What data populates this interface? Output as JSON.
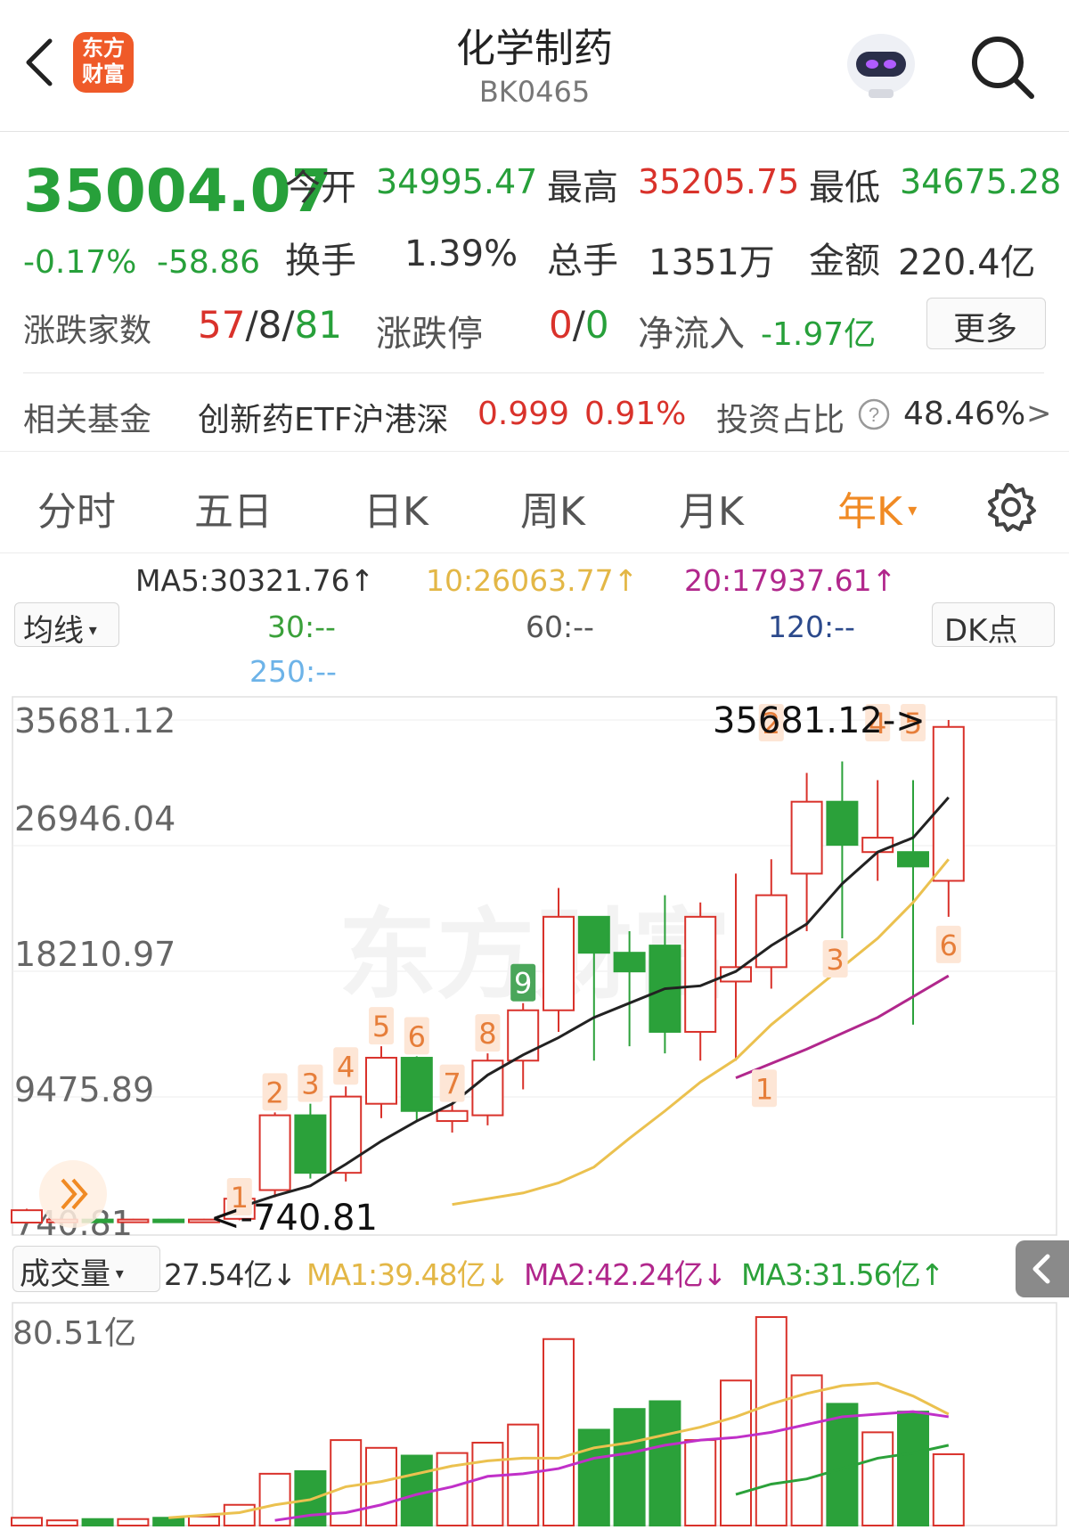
{
  "header": {
    "title": "化学制药",
    "code": "BK0465",
    "logo_line1": "东方",
    "logo_line2": "财富"
  },
  "quote": {
    "price": "35004.07",
    "change_pct": "-0.17%",
    "change": "-58.86",
    "open_label": "今开",
    "open": "34995.47",
    "high_label": "最高",
    "high": "35205.75",
    "low_label": "最低",
    "low": "34675.28",
    "turnover_label": "换手",
    "turnover": "1.39%",
    "volume_label": "总手",
    "volume": "1351万",
    "amount_label": "金额",
    "amount": "220.4亿",
    "breadth_label": "涨跌家数",
    "up": "57",
    "flat": "8",
    "down": "81",
    "sep": "/",
    "limit_label": "涨跌停",
    "limit_up": "0",
    "limit_down": "0",
    "netflow_label": "净流入",
    "netflow": "-1.97亿",
    "more": "更多"
  },
  "fund": {
    "label": "相关基金",
    "name": "创新药ETF沪港深",
    "price": "0.999",
    "pct": "0.91%",
    "ratio_label": "投资占比",
    "ratio": "48.46%",
    "arrow": ">"
  },
  "tabs": [
    {
      "label": "分时"
    },
    {
      "label": "五日"
    },
    {
      "label": "日K"
    },
    {
      "label": "周K"
    },
    {
      "label": "月K"
    },
    {
      "label": "年K"
    }
  ],
  "tab_active_index": 5,
  "ma": {
    "ma5": "MA5:30321.76↑",
    "ma10": "10:26063.77↑",
    "ma20": "20:17937.61↑",
    "ma30": "30:--",
    "ma60": "60:--",
    "ma120": "120:--",
    "ma250": "250:--",
    "selector": "均线",
    "dk": "DK点"
  },
  "colors": {
    "up": "#d9322b",
    "down": "#2ba13a",
    "accent": "#f08a24",
    "ma5": "#222222",
    "ma10": "#ebc14f",
    "ma20": "#b1278c"
  },
  "kline": {
    "y_labels": [
      "35681.12",
      "26946.04",
      "18210.97",
      "9475.89",
      "740.81"
    ],
    "max_label": "35681.12->",
    "min_label": "<-740.81",
    "watermark": "东方财富"
  },
  "volume_panel": {
    "selector": "成交量",
    "value": "27.54亿↓",
    "ma1": "MA1:39.48亿↓",
    "ma2": "MA2:42.24亿↓",
    "ma3": "MA3:31.56亿↑",
    "max_label": "80.51亿"
  },
  "chart_data": {
    "type": "candlestick",
    "title": "",
    "y_range": [
      740.81,
      35681.12
    ],
    "candles": [
      {
        "open": 740,
        "close": 1600,
        "high": 1700,
        "low": 700,
        "volume": 3.0
      },
      {
        "open": 900,
        "close": 950,
        "high": 1000,
        "low": 850,
        "volume": 2.0
      },
      {
        "open": 950,
        "close": 900,
        "high": 1000,
        "low": 850,
        "volume": 2.5
      },
      {
        "open": 900,
        "close": 950,
        "high": 1000,
        "low": 850,
        "volume": 2.5
      },
      {
        "open": 950,
        "close": 900,
        "high": 1000,
        "low": 850,
        "volume": 3.0
      },
      {
        "open": 900,
        "close": 950,
        "high": 1000,
        "low": 850,
        "volume": 3.5
      },
      {
        "open": 1000,
        "close": 2400,
        "high": 2600,
        "low": 900,
        "volume": 8.0
      },
      {
        "open": 3000,
        "close": 8200,
        "high": 8400,
        "low": 2500,
        "volume": 20.0
      },
      {
        "open": 8200,
        "close": 4200,
        "high": 9000,
        "low": 3800,
        "volume": 21.0
      },
      {
        "open": 4200,
        "close": 9500,
        "high": 10200,
        "low": 3600,
        "volume": 33.0
      },
      {
        "open": 9000,
        "close": 12200,
        "high": 13000,
        "low": 8000,
        "volume": 30.0
      },
      {
        "open": 12200,
        "close": 8500,
        "high": 12300,
        "low": 7800,
        "volume": 27.0
      },
      {
        "open": 7800,
        "close": 8500,
        "high": 9000,
        "low": 7000,
        "volume": 28.0
      },
      {
        "open": 8200,
        "close": 12000,
        "high": 12500,
        "low": 7500,
        "volume": 32.0
      },
      {
        "open": 12000,
        "close": 15500,
        "high": 16000,
        "low": 10000,
        "volume": 39.0
      },
      {
        "open": 15500,
        "close": 22000,
        "high": 24000,
        "low": 14000,
        "volume": 72.0
      },
      {
        "open": 22000,
        "close": 19500,
        "high": 22000,
        "low": 12000,
        "volume": 37.0
      },
      {
        "open": 19500,
        "close": 18200,
        "high": 21000,
        "low": 13000,
        "volume": 45.0
      },
      {
        "open": 20000,
        "close": 14000,
        "high": 23500,
        "low": 12500,
        "volume": 48.0
      },
      {
        "open": 14000,
        "close": 22000,
        "high": 23000,
        "low": 12000,
        "volume": 33.0
      },
      {
        "open": 17500,
        "close": 18500,
        "high": 25000,
        "low": 12000,
        "volume": 56.0
      },
      {
        "open": 18500,
        "close": 23500,
        "high": 26000,
        "low": 17000,
        "volume": 80.5
      },
      {
        "open": 25000,
        "close": 30000,
        "high": 32000,
        "low": 21000,
        "volume": 58.0
      },
      {
        "open": 30000,
        "close": 27000,
        "high": 32800,
        "low": 20500,
        "volume": 47.0
      },
      {
        "open": 26500,
        "close": 27500,
        "high": 31500,
        "low": 24500,
        "volume": 36.0
      },
      {
        "open": 26500,
        "close": 25500,
        "high": 31500,
        "low": 14500,
        "volume": 44.0
      },
      {
        "open": 24500,
        "close": 35200,
        "high": 35681,
        "low": 22000,
        "volume": 27.54
      }
    ],
    "ma5": [
      null,
      null,
      null,
      null,
      null,
      null,
      1800,
      2600,
      3300,
      4800,
      6400,
      7800,
      9000,
      11000,
      12400,
      13600,
      15000,
      16000,
      17000,
      17200,
      18200,
      20000,
      21500,
      24300,
      26500,
      27500,
      30300
    ],
    "ma10": [
      null,
      null,
      null,
      null,
      null,
      null,
      null,
      null,
      null,
      null,
      null,
      null,
      2000,
      2400,
      2800,
      3500,
      4600,
      6600,
      8500,
      10500,
      12100,
      14500,
      16500,
      18500,
      20500,
      23000,
      26000
    ],
    "ma20": [
      null,
      null,
      null,
      null,
      null,
      null,
      null,
      null,
      null,
      null,
      null,
      null,
      null,
      null,
      null,
      null,
      null,
      null,
      null,
      null,
      10800,
      null,
      null,
      null,
      null,
      null,
      17900
    ],
    "vol_ma1": [
      null,
      null,
      null,
      null,
      3,
      4,
      5,
      8,
      10,
      15,
      17,
      20,
      23,
      25,
      26,
      26,
      30,
      32,
      35,
      38,
      42,
      47,
      51,
      54,
      55,
      50,
      43
    ],
    "vol_ma2": [
      null,
      null,
      null,
      null,
      null,
      null,
      null,
      2,
      4,
      5,
      8,
      12,
      15,
      19,
      20,
      22,
      26,
      28,
      31,
      33,
      34,
      36,
      39,
      42,
      43,
      44,
      42
    ],
    "vol_ma3": [
      null,
      null,
      null,
      null,
      null,
      null,
      null,
      null,
      null,
      null,
      null,
      null,
      null,
      null,
      null,
      null,
      null,
      null,
      null,
      null,
      12,
      16,
      18,
      22,
      26,
      28,
      31
    ],
    "labels": [
      {
        "index": 6,
        "text": "1",
        "pos": "below-high"
      },
      {
        "index": 7,
        "text": "2",
        "pos": "above"
      },
      {
        "index": 8,
        "text": "3",
        "pos": "above"
      },
      {
        "index": 9,
        "text": "4",
        "pos": "above"
      },
      {
        "index": 10,
        "text": "5",
        "pos": "above"
      },
      {
        "index": 11,
        "text": "6",
        "pos": "above"
      },
      {
        "index": 12,
        "text": "7",
        "pos": "above"
      },
      {
        "index": 13,
        "text": "8",
        "pos": "above"
      },
      {
        "index": 14,
        "text": "9",
        "pos": "above",
        "style": "green"
      },
      {
        "index": 20,
        "text": "1",
        "pos": "right-low"
      },
      {
        "index": 21,
        "text": "2",
        "pos": "top"
      },
      {
        "index": 22,
        "text": "3",
        "pos": "right-low"
      },
      {
        "index": 24,
        "text": "4",
        "pos": "top"
      },
      {
        "index": 25,
        "text": "5",
        "pos": "top"
      },
      {
        "index": 26,
        "text": "6",
        "pos": "below"
      }
    ]
  }
}
